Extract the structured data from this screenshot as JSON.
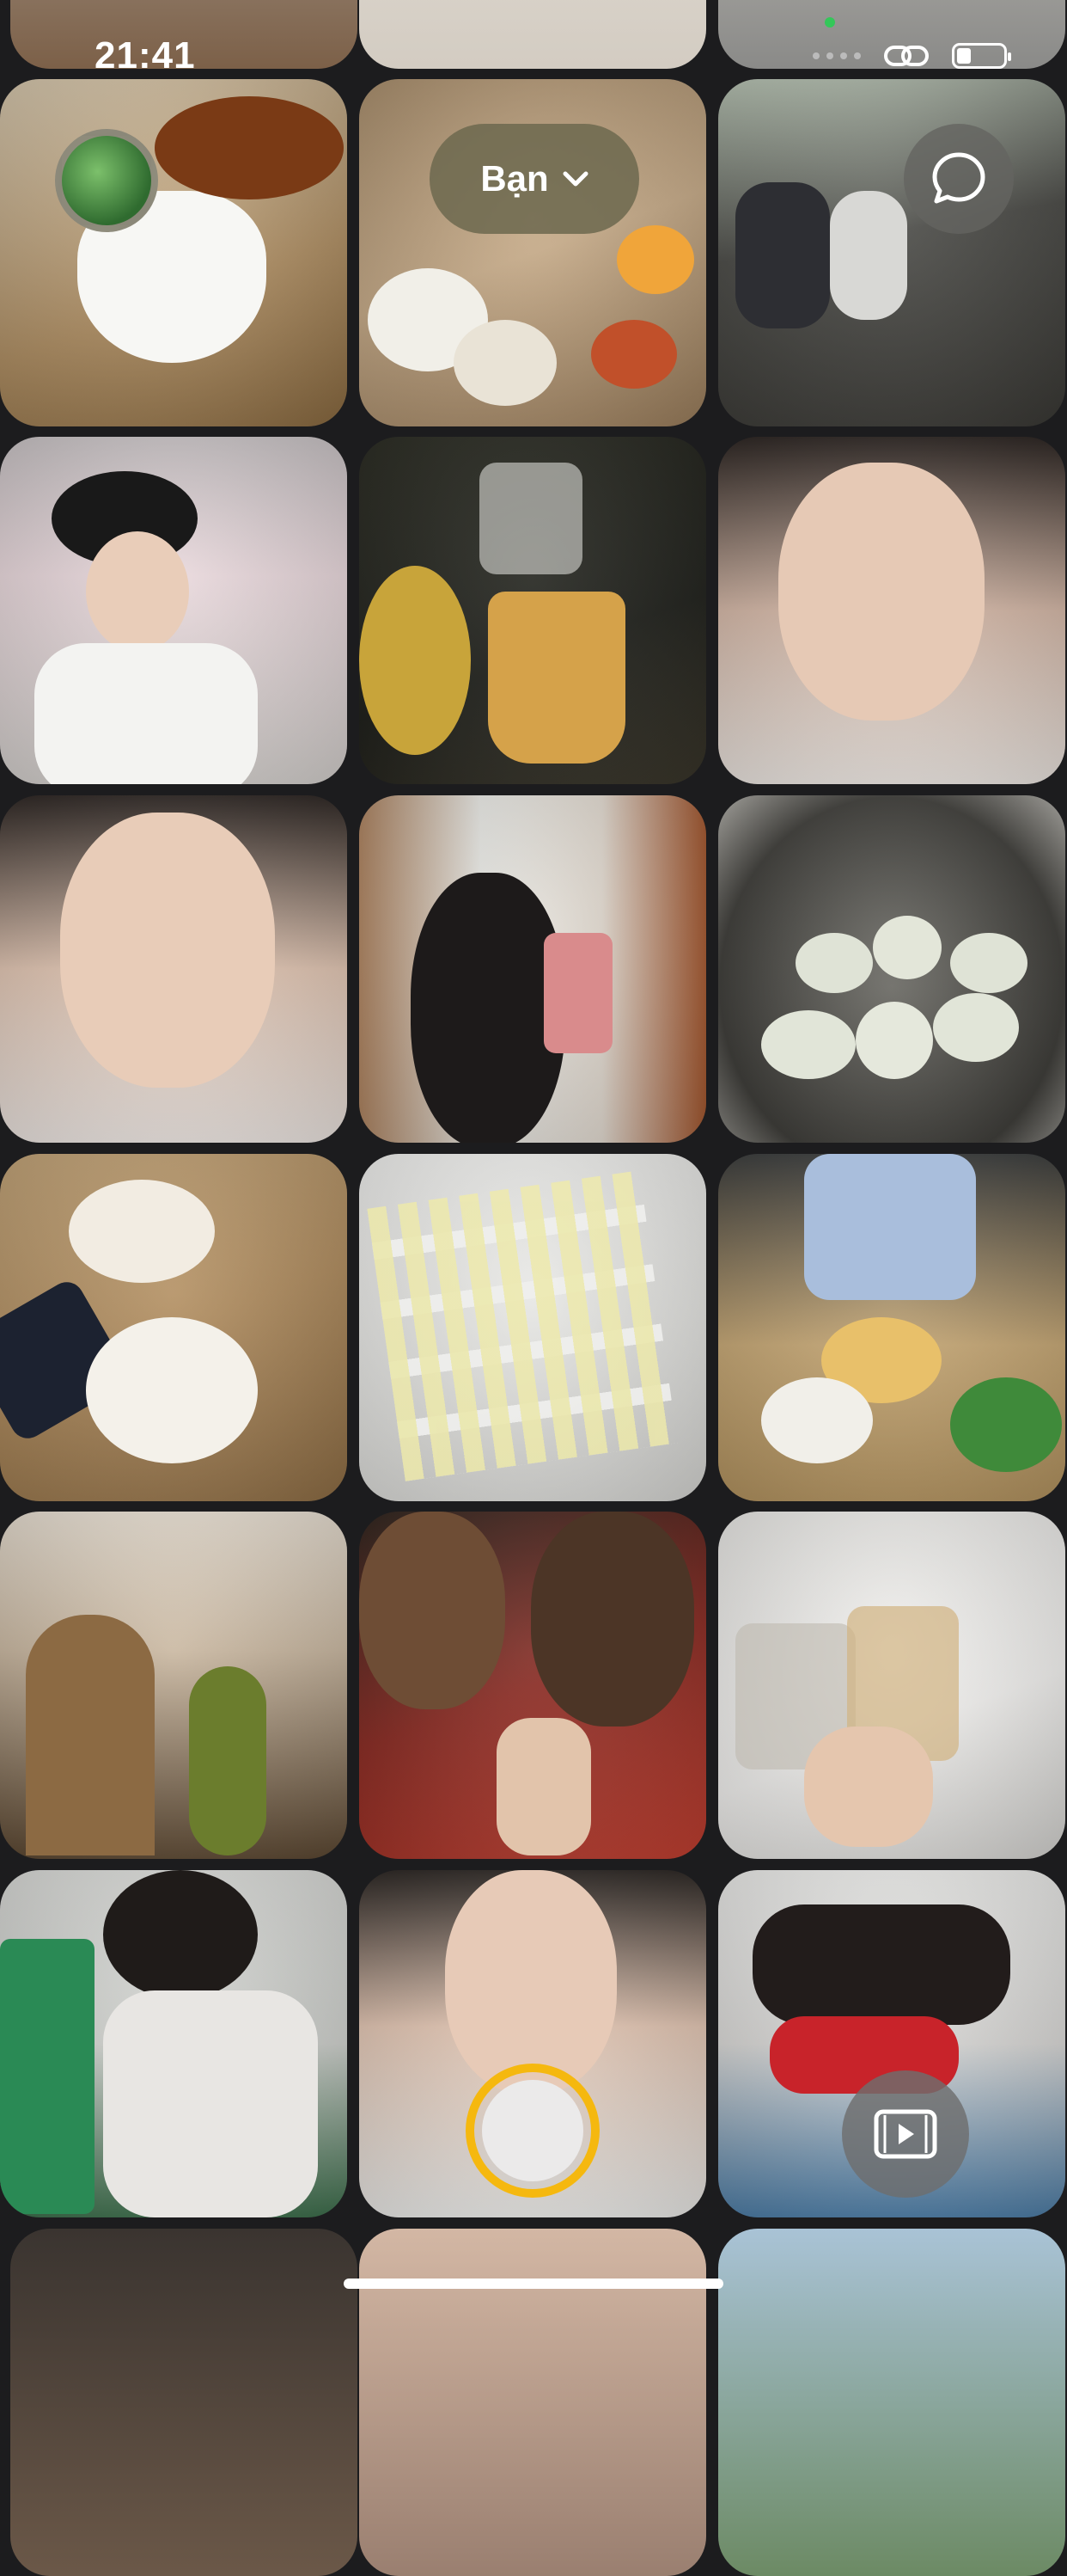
{
  "status_bar": {
    "time": "21:41"
  },
  "header": {
    "friends_selector_label": "Bạn"
  },
  "icons": {
    "avatar": "profile-avatar",
    "chevron": "chevron-down-icon",
    "chat": "chat-bubble-icon",
    "shutter": "shutter-button",
    "video": "video-icon",
    "link": "link-icon",
    "battery": "battery-icon"
  },
  "colors": {
    "background": "#1c1c1e",
    "shutter_ring": "#f5b80f",
    "pill": "#6e6a50"
  },
  "photos": [
    {
      "id": "p1",
      "subject": "cup-on-table"
    },
    {
      "id": "p2",
      "subject": "food-dishes"
    },
    {
      "id": "p3",
      "subject": "people-sitting-street"
    },
    {
      "id": "p4",
      "subject": "selfie-hat"
    },
    {
      "id": "p5",
      "subject": "drinks-table"
    },
    {
      "id": "p6",
      "subject": "selfie-tongue"
    },
    {
      "id": "p7",
      "subject": "selfie-portrait"
    },
    {
      "id": "p8",
      "subject": "mirror-selfie"
    },
    {
      "id": "p9",
      "subject": "duck-eggs-pot"
    },
    {
      "id": "p10",
      "subject": "bowls-soup"
    },
    {
      "id": "p11",
      "subject": "notes-wall"
    },
    {
      "id": "p12",
      "subject": "meal-table"
    },
    {
      "id": "p13",
      "subject": "church-interior"
    },
    {
      "id": "p14",
      "subject": "masked-selfie"
    },
    {
      "id": "p15",
      "subject": "drinks-toast"
    },
    {
      "id": "p16",
      "subject": "girl-outdoor"
    },
    {
      "id": "p17",
      "subject": "selfie-pout"
    },
    {
      "id": "p18",
      "subject": "two-girls"
    }
  ]
}
